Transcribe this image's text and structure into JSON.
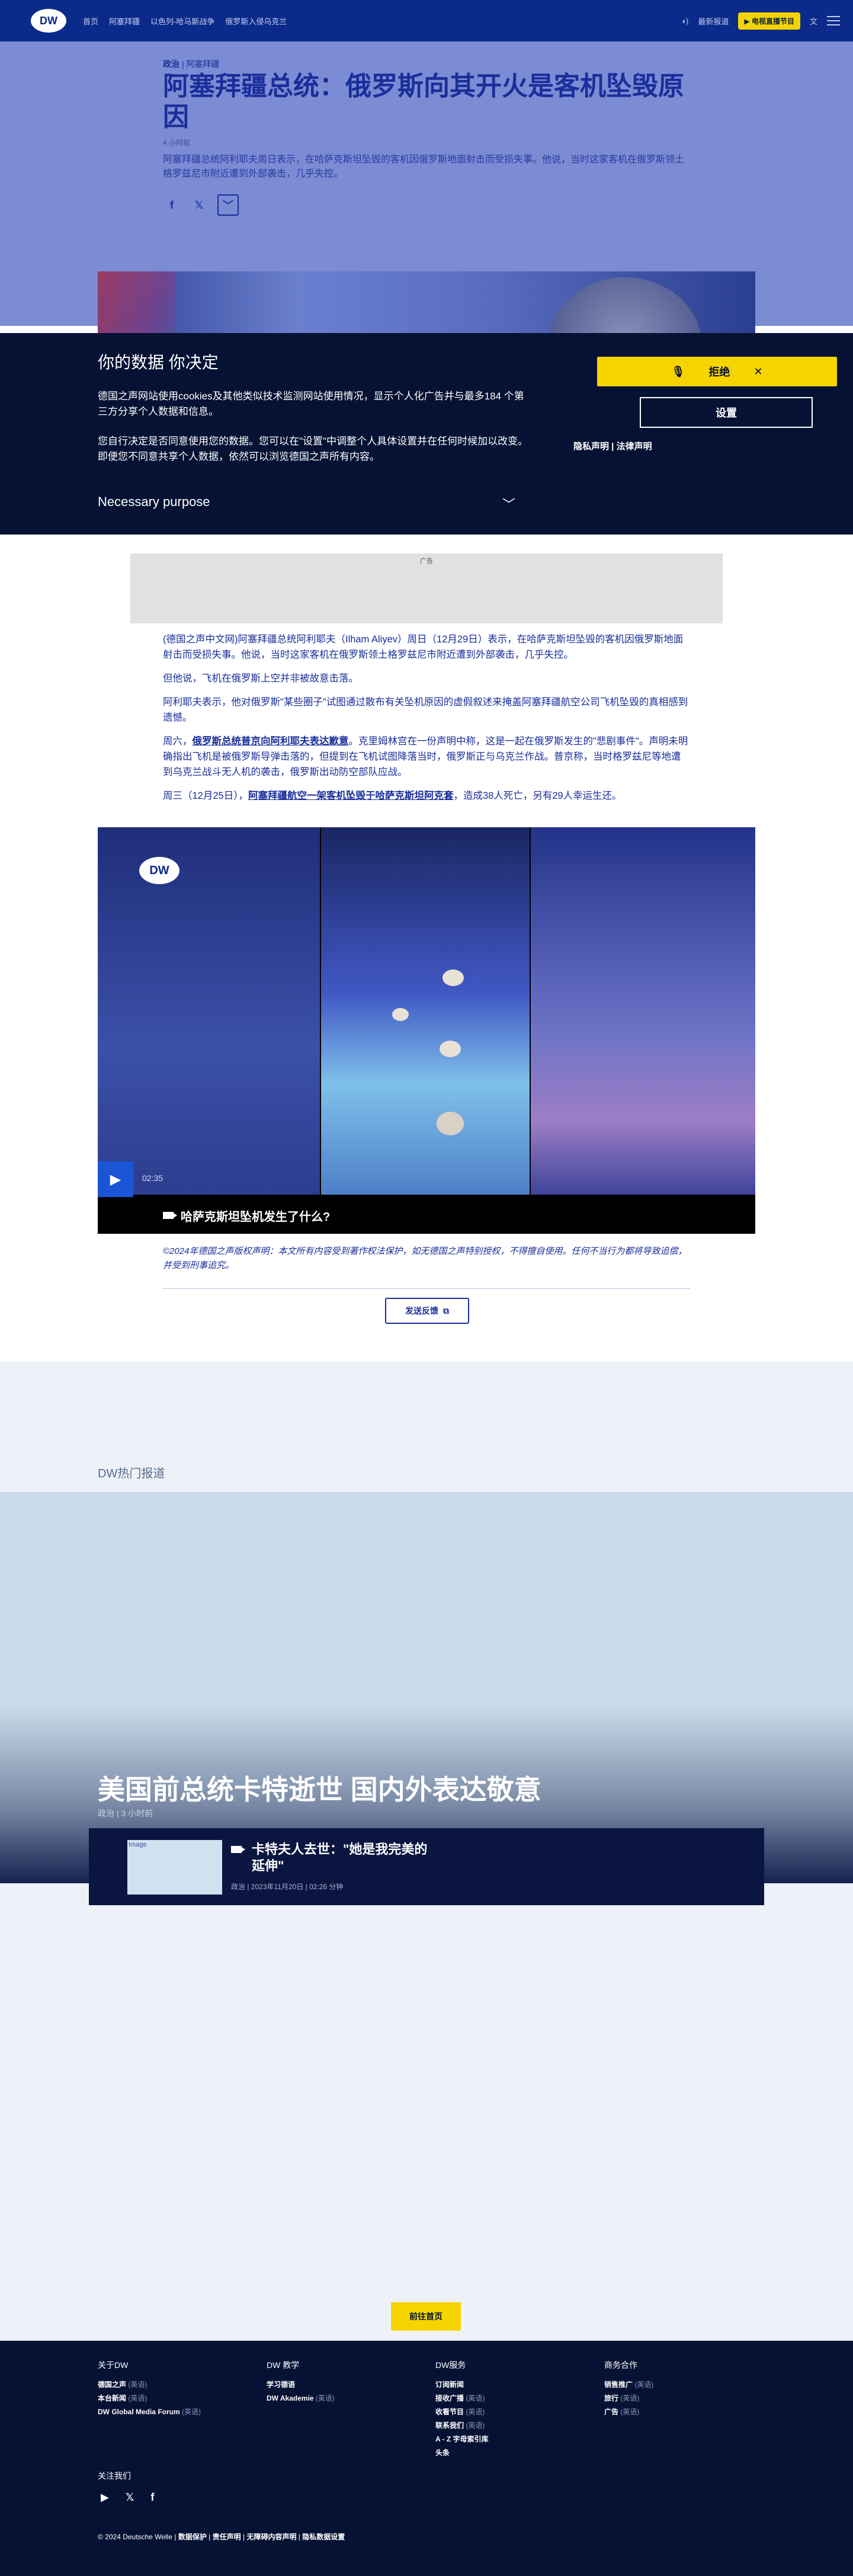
{
  "header": {
    "logo": "DW",
    "nav": [
      "首页",
      "阿塞拜疆",
      "以色列-哈马斯战争",
      "俄罗斯入侵乌克兰"
    ],
    "login": "最新报道",
    "live": "电视直播节目",
    "lang": "文"
  },
  "article": {
    "category": "政治",
    "region": "阿塞拜疆",
    "title": "阿塞拜疆总统：俄罗斯向其开火是客机坠毁原因",
    "time": "4 小时前",
    "lead": "阿塞拜疆总统阿利耶夫周日表示，在哈萨克斯坦坠毁的客机因俄罗斯地面射击而受损失事。他说，当时这家客机在俄罗斯领土格罗兹尼市附近遭到外部袭击，几乎失控。",
    "share_icons": [
      "facebook-icon",
      "x-icon",
      "more-icon"
    ],
    "ad_label": "广告",
    "paragraphs": [
      "(德国之声中文网)阿塞拜疆总统阿利耶夫（Ilham Aliyev）周日（12月29日）表示，在哈萨克斯坦坠毁的客机因俄罗斯地面射击而受损失事。他说，当时这家客机在俄罗斯领土格罗兹尼市附近遭到外部袭击，几乎失控。",
      "但他说，飞机在俄罗斯上空并非被故意击落。",
      "阿利耶夫表示，他对俄罗斯\"某些圈子\"试图通过散布有关坠机原因的虚假叙述来掩盖阿塞拜疆航空公司飞机坠毁的真相感到遗憾。"
    ],
    "p4_prefix": "周六，",
    "p4_link": "俄罗斯总统普京向阿利耶夫表达歉意",
    "p4_rest": "。克里姆林宫在一份声明中称，这是一起在俄罗斯发生的\"悲剧事件\"。声明未明确指出飞机是被俄罗斯导弹击落的，但提到在飞机试图降落当时，俄罗斯正与乌克兰作战。普京称，当时格罗兹尼等地遭到乌克兰战斗无人机的袭击，俄罗斯出动防空部队应战。",
    "p5_prefix": "周三（12月25日），",
    "p5_link": "阿塞拜疆航空一架客机坠毁于哈萨克斯坦阿克套",
    "p5_rest": "，造成38人死亡，另有29人幸运生还。",
    "video": {
      "logo": "DW",
      "duration": "02:35",
      "caption": "哈萨克斯坦坠机发生了什么?"
    },
    "copyright": "©2024年德国之声版权声明：本文所有内容受到著作权法保护，如无德国之声特别授权，不得擅自使用。任何不当行为都将导致追偿，并受到刑事追究。",
    "feedback": "发送反馈"
  },
  "cookie": {
    "title": "你的数据 你决定",
    "text1": "德国之声网站使用cookies及其他类似技术监测网站使用情况，显示个人化广告并与最多184 个第三方分享个人数据和信息。",
    "text2": "您自行决定是否同意使用您的数据。您可以在\"设置\"中调整个人具体设置并在任何时候加以改变。即便您不同意共享个人数据，依然可以浏览德国之声所有内容。",
    "purpose": "Necessary purpose",
    "reject": "拒绝",
    "settings": "设置",
    "privacy": "隐私声明",
    "legal": "法律声明"
  },
  "hot": {
    "section_title": "DW热门报道",
    "headline": "美国前总统卡特逝世 国内外表达敬意",
    "meta": "政治 | 3 小时前",
    "card_title": "卡特夫人去世：\"她是我完美的延伸\"",
    "card_meta": "政治 | 2023年11月20日 | 02:26 分钟",
    "thumb_alt": "Image",
    "home_button": "前往首页"
  },
  "footer": {
    "columns": [
      {
        "title": "关于DW",
        "items": [
          {
            "t": "德国之声",
            "s": "(英语)"
          },
          {
            "t": "本台新闻",
            "s": "(英语)"
          },
          {
            "t": "DW Global Media Forum",
            "s": "(英语)"
          }
        ]
      },
      {
        "title": "DW 教学",
        "items": [
          {
            "t": "学习德语",
            "s": ""
          },
          {
            "t": "DW Akademie",
            "s": "(英语)"
          }
        ]
      },
      {
        "title": "DW服务",
        "items": [
          {
            "t": "订阅新闻",
            "s": ""
          },
          {
            "t": "接收广播",
            "s": "(英语)"
          },
          {
            "t": "收看节目",
            "s": "(英语)"
          },
          {
            "t": "联系我们",
            "s": "(英语)"
          },
          {
            "t": "A - Z 字母索引库",
            "s": ""
          },
          {
            "t": "头条",
            "s": ""
          }
        ]
      },
      {
        "title": "商务合作",
        "items": [
          {
            "t": "销售推广",
            "s": "(英语)"
          },
          {
            "t": "旅行",
            "s": "(英语)"
          },
          {
            "t": "广告",
            "s": "(英语)"
          }
        ]
      }
    ],
    "follow": "关注我们",
    "social_icons": [
      "youtube-icon",
      "x-icon",
      "facebook-icon"
    ],
    "legal": [
      "© 2024 Deutsche Welle",
      "数据保护",
      "责任声明",
      "无障碍内容声明",
      "隐私数据设置"
    ]
  }
}
